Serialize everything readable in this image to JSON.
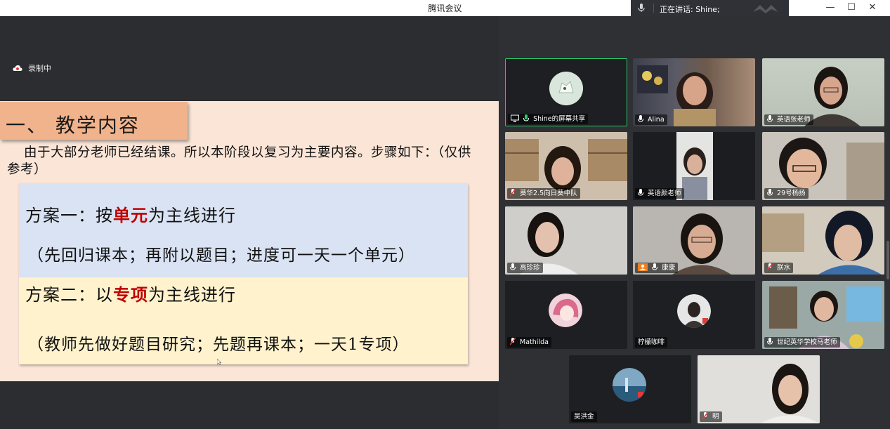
{
  "window": {
    "title": "腾讯会议",
    "speaking_text": "正在讲话: Shine;",
    "minimize": "—",
    "maximize": "☐",
    "close": "✕"
  },
  "recording": {
    "label": "录制中"
  },
  "slide": {
    "title": "一、 教学内容",
    "intro": "由于大部分老师已经结课。所以本阶段以复习为主要内容。步骤如下：（仅供参考）",
    "plan1": {
      "prefix": "方案一：按",
      "highlight": "单元",
      "suffix": "为主线进行",
      "note": "（先回归课本；再附以题目；进度可一天一个单元）"
    },
    "plan2": {
      "prefix": "方案二：以",
      "highlight": "专项",
      "suffix": "为主线进行",
      "note": "（教师先做好题目研究；先题再课本；一天1专项）"
    }
  },
  "participants": [
    {
      "name": "Shine的屏幕共享",
      "active": true,
      "muted": false
    },
    {
      "name": "Alina",
      "muted": false
    },
    {
      "name": "英语张老师",
      "muted": false
    },
    {
      "name": "葵华2.5向日葵中队",
      "muted": true
    },
    {
      "name": "英语颜老师",
      "muted": false
    },
    {
      "name": "29号杨扬",
      "muted": false
    },
    {
      "name": "高珍珍",
      "muted": false
    },
    {
      "name": "康康",
      "muted": false
    },
    {
      "name": "朕水",
      "muted": true
    },
    {
      "name": "Mathilda",
      "muted": true
    },
    {
      "name": "柠檬咖啡",
      "muted": false
    },
    {
      "name": "世纪英华学校马老师",
      "muted": false
    },
    {
      "name": "吴洪金",
      "muted": false
    },
    {
      "name": "明",
      "muted": true
    }
  ],
  "colors": {
    "accent_green": "#2bc96a",
    "highlight_red": "#c00000",
    "muted_red": "#e03c3c",
    "slide_bg": "#fae5d7",
    "title_bg": "#f1b38c"
  }
}
